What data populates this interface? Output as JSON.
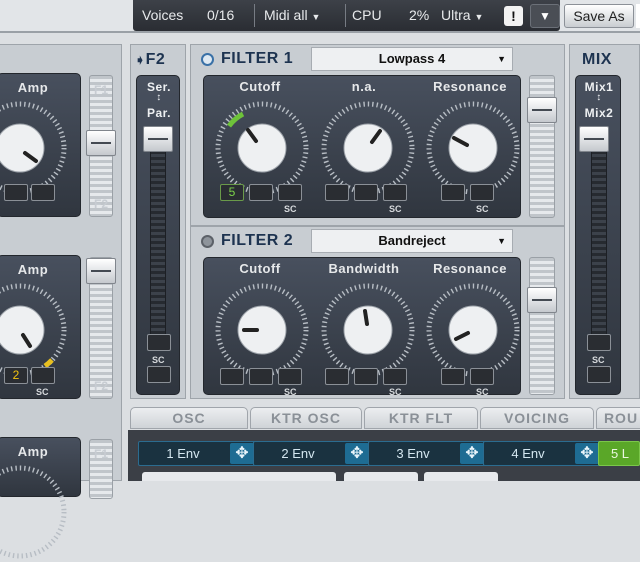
{
  "topbar": {
    "voices_label": "Voices",
    "voices_value": "0/16",
    "midi_value": "Midi all",
    "cpu_label": "CPU",
    "cpu_value": "2%",
    "quality_value": "Ultra",
    "warning_label": "!",
    "save_as_label": "Save As"
  },
  "left_column": {
    "units": [
      {
        "param_label": "Amp",
        "slider_top_label": "F1",
        "slider_bottom_label": "F2"
      },
      {
        "param_label": "Amp",
        "mod_value": "2",
        "sc_label": "SC",
        "slider_bottom_label": "F2"
      },
      {
        "param_label": "Amp",
        "slider_top_label": "F1"
      }
    ]
  },
  "f2_routing": {
    "header": "F2",
    "mode_top": "Ser.",
    "mode_bottom": "Par.",
    "sc_label": "SC"
  },
  "filter1": {
    "title": "FILTER 1",
    "type": "Lowpass 4",
    "knobs": [
      {
        "label": "Cutoff",
        "mod_value": "5"
      },
      {
        "label": "n.a."
      },
      {
        "label": "Resonance"
      }
    ],
    "sc_label": "SC"
  },
  "filter2": {
    "title": "FILTER 2",
    "type": "Bandreject",
    "knobs": [
      {
        "label": "Cutoff"
      },
      {
        "label": "Bandwidth"
      },
      {
        "label": "Resonance"
      }
    ],
    "sc_label": "SC"
  },
  "mix": {
    "header": "MIX",
    "top_label": "Mix1",
    "bottom_label": "Mix2",
    "sc_label": "SC"
  },
  "tabs": [
    "OSC",
    "KTR OSC",
    "KTR FLT",
    "VOICING",
    "ROU"
  ],
  "envelopes": [
    "1 Env",
    "2 Env",
    "3 Env",
    "4 Env",
    "5 L"
  ],
  "colors": {
    "panel_dark": "#353b45",
    "accent_blue": "#1d3350",
    "mod_yellow": "#f1c40f",
    "env_blue": "#1e6c93",
    "env_green": "#5aa728"
  }
}
